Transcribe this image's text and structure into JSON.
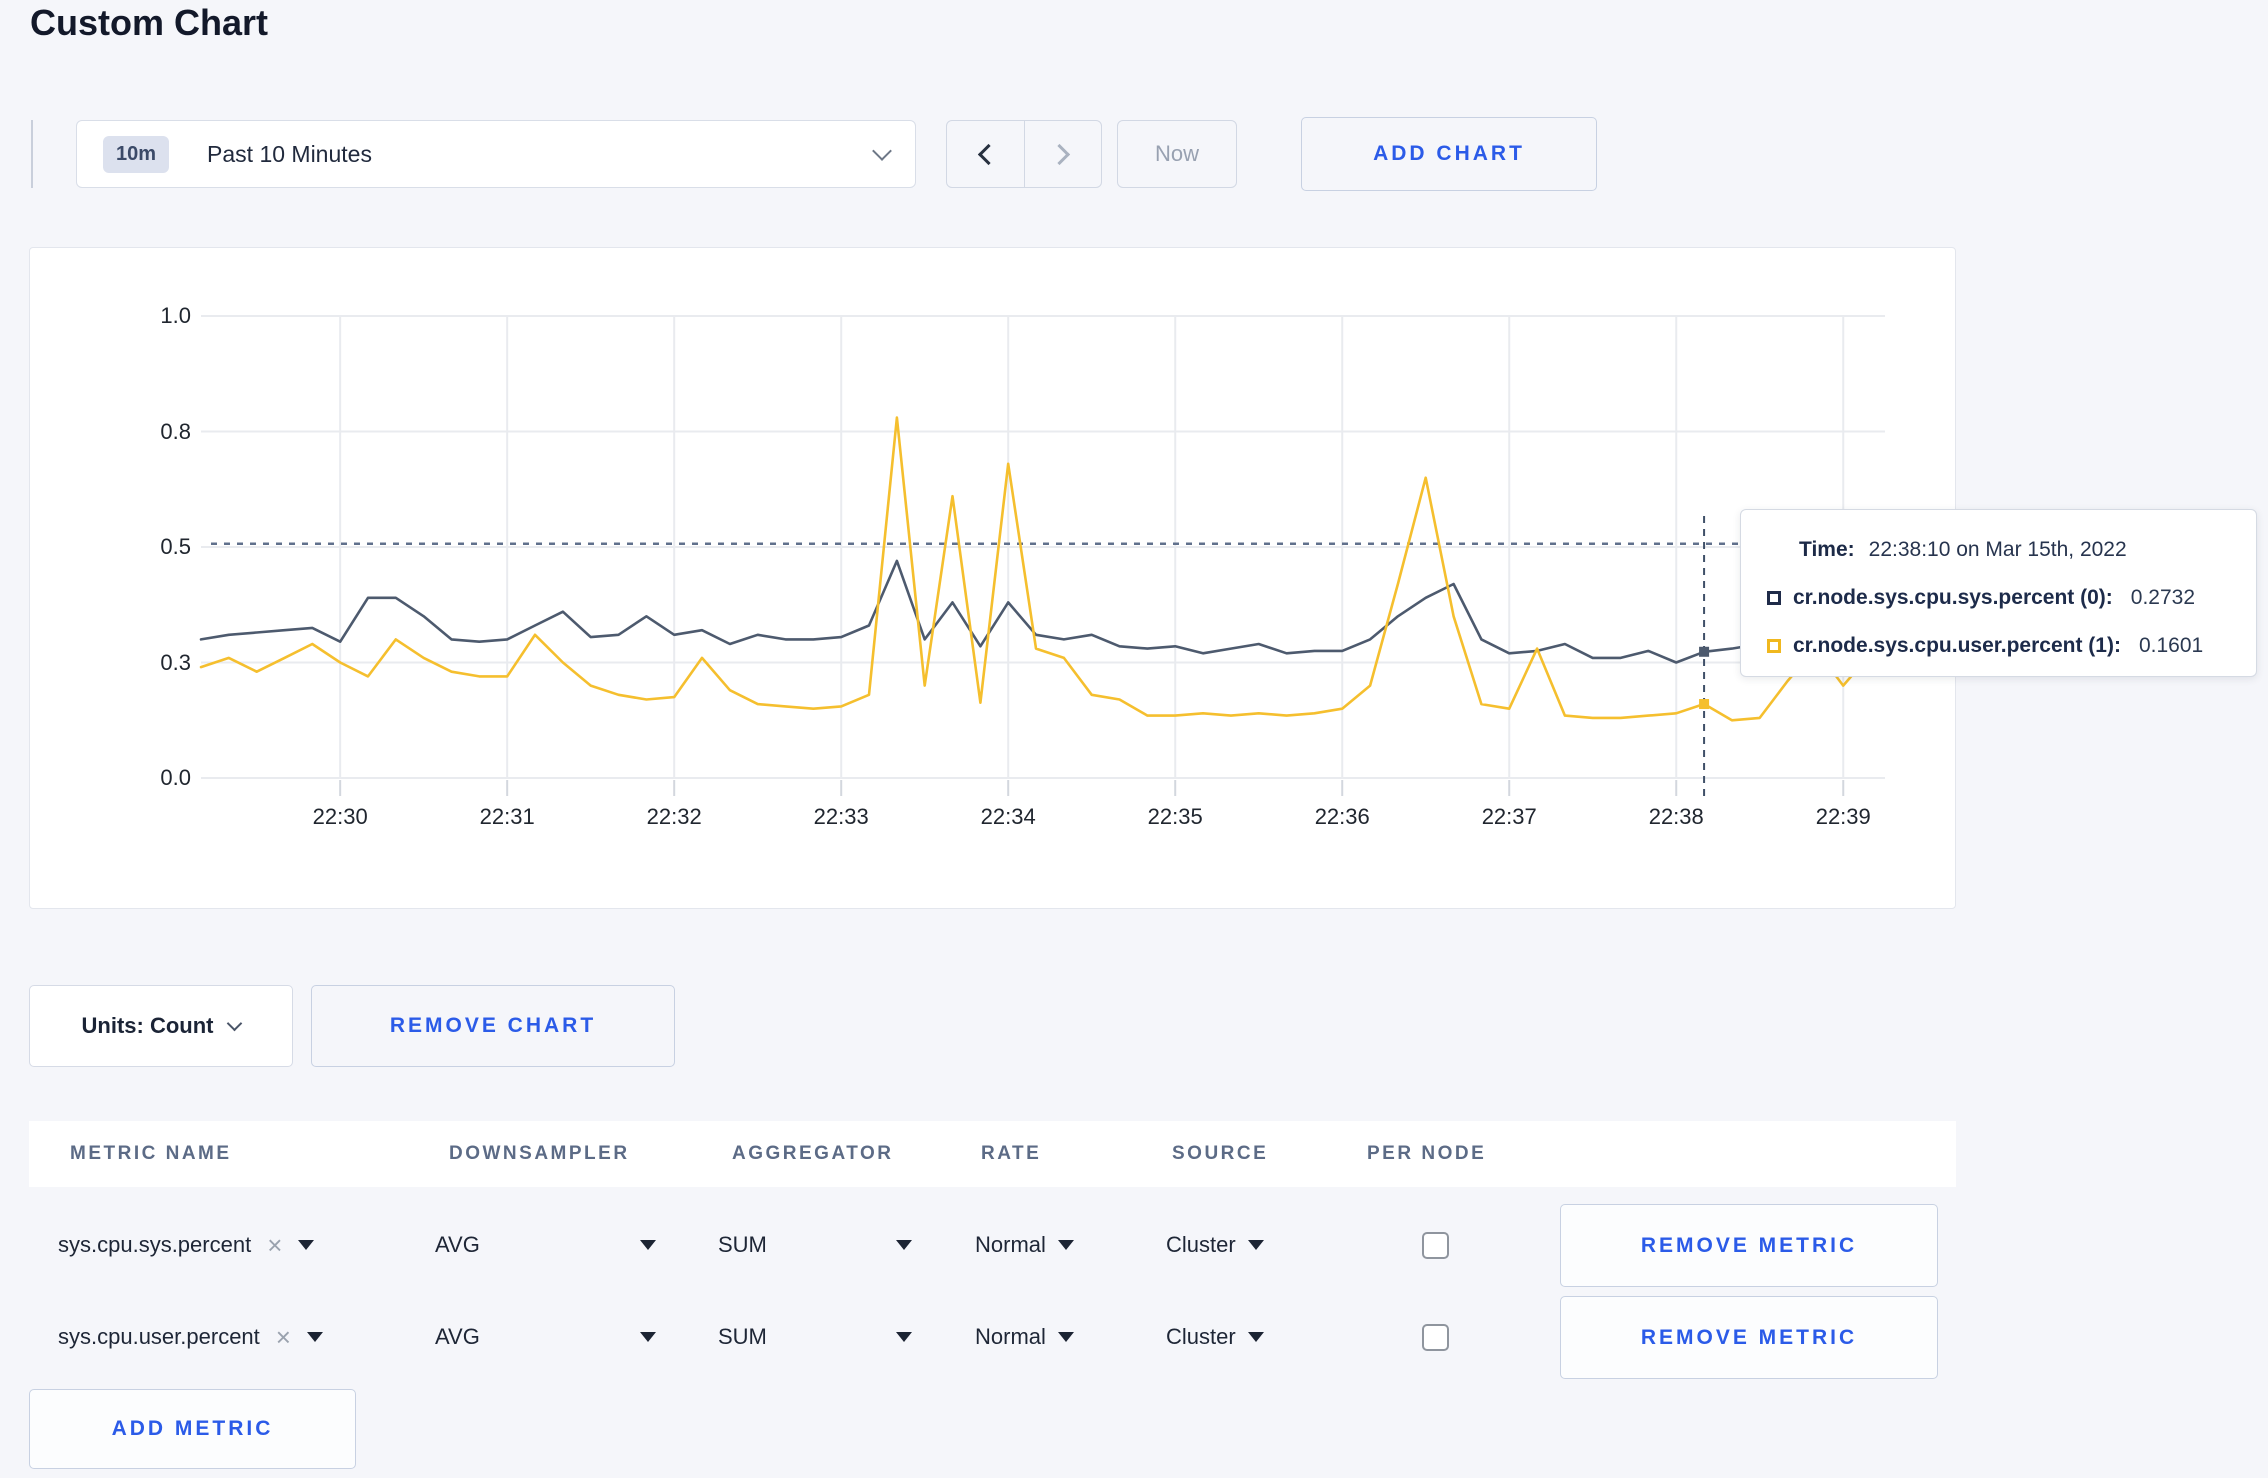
{
  "page": {
    "title": "Custom Chart"
  },
  "colors": {
    "accent_blue": "#2b5be8",
    "series_sys": "#4d5a6e",
    "series_user": "#f5bf2e",
    "grid": "#e9ebef",
    "threshold": "#60708c"
  },
  "toolbar": {
    "time_badge": "10m",
    "time_label": "Past 10 Minutes",
    "now_label": "Now",
    "add_chart_label": "ADD CHART"
  },
  "icons": {
    "clear": "×"
  },
  "chart_data": {
    "type": "line",
    "title": "",
    "xlabel": "",
    "ylabel": "",
    "ylim": [
      0,
      1
    ],
    "grid": true,
    "x_start": "22:29:10",
    "x_step_seconds": 10,
    "x_tick_labels": [
      "22:30",
      "22:31",
      "22:32",
      "22:33",
      "22:34",
      "22:35",
      "22:36",
      "22:37",
      "22:38",
      "22:39"
    ],
    "y_ticks": [
      0,
      0.25,
      0.5,
      0.75,
      1.0
    ],
    "y_tick_labels": [
      "0.0",
      "0.3",
      "0.5",
      "0.8",
      "1.0"
    ],
    "threshold_value": 0.507,
    "hover": {
      "index": 54,
      "time": "22:38:10",
      "values": [
        0.2732,
        0.1601
      ]
    },
    "series": [
      {
        "name": "cr.node.sys.cpu.sys.percent (0)",
        "color": "#4d5a6e",
        "values": [
          0.3,
          0.31,
          0.315,
          0.32,
          0.325,
          0.295,
          0.39,
          0.39,
          0.35,
          0.3,
          0.295,
          0.3,
          0.33,
          0.36,
          0.305,
          0.31,
          0.35,
          0.31,
          0.32,
          0.29,
          0.31,
          0.3,
          0.3,
          0.305,
          0.33,
          0.47,
          0.3,
          0.38,
          0.285,
          0.38,
          0.31,
          0.3,
          0.31,
          0.285,
          0.28,
          0.285,
          0.27,
          0.28,
          0.29,
          0.27,
          0.275,
          0.275,
          0.3,
          0.35,
          0.39,
          0.42,
          0.3,
          0.27,
          0.275,
          0.29,
          0.26,
          0.26,
          0.275,
          0.25,
          0.2732,
          0.28,
          0.29,
          0.285,
          0.3,
          0.29,
          0.3
        ]
      },
      {
        "name": "cr.node.sys.cpu.user.percent (1)",
        "color": "#f5bf2e",
        "values": [
          0.24,
          0.26,
          0.23,
          0.26,
          0.29,
          0.25,
          0.22,
          0.3,
          0.26,
          0.23,
          0.22,
          0.22,
          0.31,
          0.25,
          0.2,
          0.18,
          0.17,
          0.175,
          0.26,
          0.19,
          0.16,
          0.155,
          0.15,
          0.155,
          0.18,
          0.78,
          0.2,
          0.61,
          0.163,
          0.68,
          0.28,
          0.26,
          0.18,
          0.17,
          0.135,
          0.135,
          0.14,
          0.135,
          0.14,
          0.135,
          0.14,
          0.15,
          0.2,
          0.42,
          0.65,
          0.35,
          0.16,
          0.15,
          0.28,
          0.135,
          0.13,
          0.13,
          0.135,
          0.14,
          0.1601,
          0.125,
          0.13,
          0.21,
          0.28,
          0.2,
          0.27
        ]
      }
    ]
  },
  "tooltip": {
    "time_label": "Time:",
    "time_value": "22:38:10 on Mar 15th, 2022",
    "series": [
      {
        "name_label": "cr.node.sys.cpu.sys.percent (0):",
        "value": "0.2732"
      },
      {
        "name_label": "cr.node.sys.cpu.user.percent (1):",
        "value": "0.1601"
      }
    ]
  },
  "controls": {
    "units_label": "Units: Count",
    "remove_chart_label": "REMOVE CHART",
    "add_metric_label": "ADD METRIC"
  },
  "metrics_table": {
    "headers": [
      "METRIC NAME",
      "DOWNSAMPLER",
      "AGGREGATOR",
      "RATE",
      "SOURCE",
      "PER NODE"
    ],
    "rows": [
      {
        "metric": "sys.cpu.sys.percent",
        "downsampler": "AVG",
        "aggregator": "SUM",
        "rate": "Normal",
        "source": "Cluster",
        "per_node_checked": false,
        "remove_label": "REMOVE METRIC"
      },
      {
        "metric": "sys.cpu.user.percent",
        "downsampler": "AVG",
        "aggregator": "SUM",
        "rate": "Normal",
        "source": "Cluster",
        "per_node_checked": false,
        "remove_label": "REMOVE METRIC"
      }
    ]
  }
}
